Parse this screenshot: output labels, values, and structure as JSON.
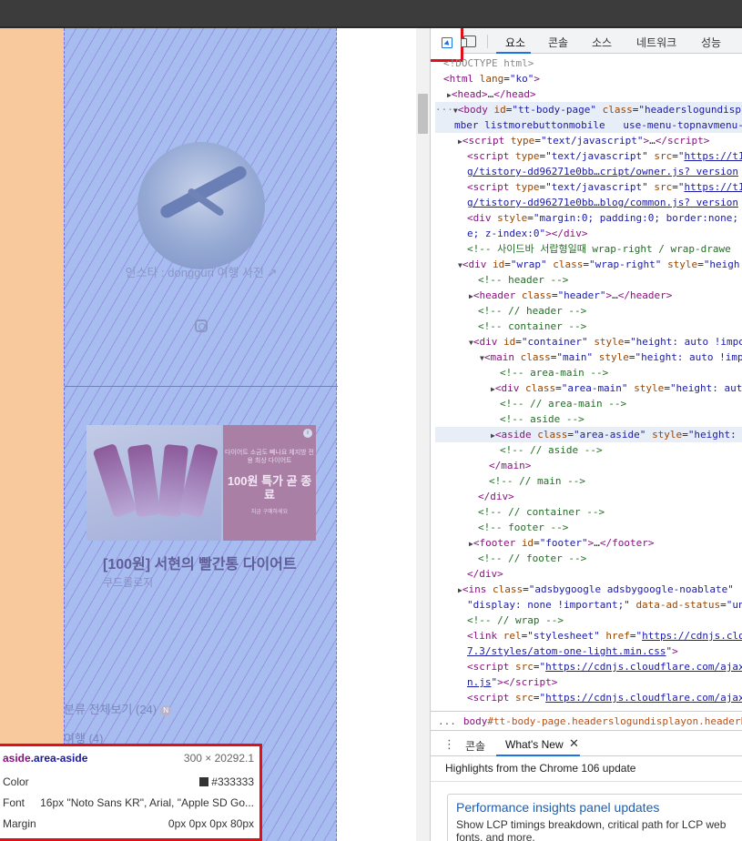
{
  "page": {
    "insta_caption": "인스타 : dongguri 여행 사진 ↗",
    "ad": {
      "small_text": "다이어트 소금도 빼나요 체지방 전용 최상 다이어트",
      "big_text": "100원 특가 곧 종료",
      "tiny_text": "지금 구매하세요",
      "info_label": "i",
      "title": "[100원] 서현의 빨간통 다이어트",
      "subtitle": "쿠드롤로지"
    },
    "categories": [
      {
        "label": "분류 전체보기 (24)",
        "badge": "N"
      },
      {
        "label": "여행 (4)"
      }
    ]
  },
  "tooltip": {
    "selector_tag": "aside",
    "selector_class": ".area-aside",
    "size": "300 × 20292.1",
    "rows": [
      {
        "key": "Color",
        "value": "#333333",
        "swatch": "#333333"
      },
      {
        "key": "Font",
        "value": "16px \"Noto Sans KR\", Arial, \"Apple SD Go..."
      },
      {
        "key": "Margin",
        "value": "0px 0px 0px 80px"
      }
    ]
  },
  "devtools": {
    "tabs": [
      "요소",
      "콘솔",
      "소스",
      "네트워크",
      "성능"
    ],
    "active_tab": "요소",
    "code_lines": [
      {
        "indent": 14,
        "html": "<span class='gray'>&lt;!DOCTYPE html&gt;</span>"
      },
      {
        "indent": 14,
        "html": "<span class='tag'>&lt;html</span> <span class='at'>lang</span>=<span class='av'>\"ko\"</span><span class='tag'>&gt;</span>"
      },
      {
        "indent": 18,
        "html": "<span class='tri'>▶</span><span class='tag'>&lt;head&gt;</span>…<span class='tag'>&lt;/head&gt;</span>"
      },
      {
        "indent": 2,
        "html": "<span class='gray'>···</span><span class='tri'>▼</span><span class='tag'>&lt;body</span> <span class='at'>id</span>=<span class='av'>\"tt-body-page\"</span> <span class='at'>class</span>=<span class='av'>\"headerslogundispl</span>",
        "selected": true
      },
      {
        "indent": 26,
        "html": "<span class='av'>mber listmorebuttonmobile   use-menu-topnavmenu-</span>",
        "selected": true
      },
      {
        "indent": 30,
        "html": "<span class='tri'>▶</span><span class='tag'>&lt;script</span> <span class='at'>type</span>=<span class='av'>\"text/javascript\"</span><span class='tag'>&gt;</span>…<span class='tag'>&lt;/script&gt;</span>"
      },
      {
        "indent": 40,
        "html": "<span class='tag'>&lt;script</span> <span class='at'>type</span>=<span class='av'>\"text/javascript\"</span> <span class='at'>src</span>=<span class='av'>\"<span class='lnk'>https://t1</span></span>"
      },
      {
        "indent": 40,
        "html": "<span class='lnk'>g/tistory-dd96271e0bb…cript/owner.js? version</span>"
      },
      {
        "indent": 40,
        "html": "<span class='tag'>&lt;script</span> <span class='at'>type</span>=<span class='av'>\"text/javascript\"</span> <span class='at'>src</span>=<span class='av'>\"<span class='lnk'>https://t1</span></span>"
      },
      {
        "indent": 40,
        "html": "<span class='lnk'>g/tistory-dd96271e0bb…blog/common.js? version</span>"
      },
      {
        "indent": 40,
        "html": "<span class='tag'>&lt;div</span> <span class='at'>style</span>=<span class='av'>\"margin:0; padding:0; border:none;</span>"
      },
      {
        "indent": 40,
        "html": "<span class='av'>e; z-index:0\"</span><span class='tag'>&gt;&lt;/div&gt;</span>"
      },
      {
        "indent": 40,
        "html": "<span class='cm'>&lt;!-- 사이드바 서랍형일때 wrap-right / wrap-drawe</span>"
      },
      {
        "indent": 30,
        "html": "<span class='tri'>▼</span><span class='tag'>&lt;div</span> <span class='at'>id</span>=<span class='av'>\"wrap\"</span> <span class='at'>class</span>=<span class='av'>\"wrap-right\"</span> <span class='at'>style</span>=<span class='av'>\"heigh</span>"
      },
      {
        "indent": 52,
        "html": "<span class='cm'>&lt;!-- header --&gt;</span>"
      },
      {
        "indent": 42,
        "html": "<span class='tri'>▶</span><span class='tag'>&lt;header</span> <span class='at'>class</span>=<span class='av'>\"header\"</span><span class='tag'>&gt;</span>…<span class='tag'>&lt;/header&gt;</span>"
      },
      {
        "indent": 52,
        "html": "<span class='cm'>&lt;!-- // header --&gt;</span>"
      },
      {
        "indent": 52,
        "html": "<span class='cm'>&lt;!-- container --&gt;</span>"
      },
      {
        "indent": 42,
        "html": "<span class='tri'>▼</span><span class='tag'>&lt;div</span> <span class='at'>id</span>=<span class='av'>\"container\"</span> <span class='at'>style</span>=<span class='av'>\"height: auto !impo</span>"
      },
      {
        "indent": 54,
        "html": "<span class='tri'>▼</span><span class='tag'>&lt;main</span> <span class='at'>class</span>=<span class='av'>\"main\"</span> <span class='at'>style</span>=<span class='av'>\"height: auto !imp</span>"
      },
      {
        "indent": 76,
        "html": "<span class='cm'>&lt;!-- area-main --&gt;</span>"
      },
      {
        "indent": 66,
        "html": "<span class='tri'>▶</span><span class='tag'>&lt;div</span> <span class='at'>class</span>=<span class='av'>\"area-main\"</span> <span class='at'>style</span>=<span class='av'>\"height: aut</span>"
      },
      {
        "indent": 76,
        "html": "<span class='cm'>&lt;!-- // area-main --&gt;</span>"
      },
      {
        "indent": 76,
        "html": "<span class='cm'>&lt;!-- aside --&gt;</span>"
      },
      {
        "indent": 66,
        "html": "<span class='tri'>▶</span><span class='tag'>&lt;aside</span> <span class='at'>class</span>=<span class='av'>\"area-aside\"</span> <span class='at'>style</span>=<span class='av'>\"height: </span>",
        "selected": true
      },
      {
        "indent": 76,
        "html": "<span class='cm'>&lt;!-- // aside --&gt;</span>"
      },
      {
        "indent": 64,
        "html": "<span class='tag'>&lt;/main&gt;</span>"
      },
      {
        "indent": 64,
        "html": "<span class='cm'>&lt;!-- // main --&gt;</span>"
      },
      {
        "indent": 52,
        "html": "<span class='tag'>&lt;/div&gt;</span>"
      },
      {
        "indent": 52,
        "html": "<span class='cm'>&lt;!-- // container --&gt;</span>"
      },
      {
        "indent": 52,
        "html": "<span class='cm'>&lt;!-- footer --&gt;</span>"
      },
      {
        "indent": 42,
        "html": "<span class='tri'>▶</span><span class='tag'>&lt;footer</span> <span class='at'>id</span>=<span class='av'>\"footer\"</span><span class='tag'>&gt;</span>…<span class='tag'>&lt;/footer&gt;</span>"
      },
      {
        "indent": 52,
        "html": "<span class='cm'>&lt;!-- // footer --&gt;</span>"
      },
      {
        "indent": 40,
        "html": "<span class='tag'>&lt;/div&gt;</span>"
      },
      {
        "indent": 30,
        "html": "<span class='tri'>▶</span><span class='tag'>&lt;ins</span> <span class='at'>class</span>=<span class='av'>\"adsbygoogle adsbygoogle-noablate\"</span>"
      },
      {
        "indent": 40,
        "html": "<span class='av'>\"display: none !important;\"</span> <span class='at'>data-ad-status</span>=<span class='av'>\"un</span>"
      },
      {
        "indent": 40,
        "html": "<span class='cm'>&lt;!-- // wrap --&gt;</span>"
      },
      {
        "indent": 40,
        "html": "<span class='tag'>&lt;link</span> <span class='at'>rel</span>=<span class='av'>\"stylesheet\"</span> <span class='at'>href</span>=<span class='av'>\"<span class='lnk'>https://cdnjs.clou</span></span>"
      },
      {
        "indent": 40,
        "html": "<span class='lnk'>7.3/styles/atom-one-light.min.css</span><span class='av'>\"</span><span class='tag'>&gt;</span>"
      },
      {
        "indent": 40,
        "html": "<span class='tag'>&lt;script</span> <span class='at'>src</span>=<span class='av'>\"<span class='lnk'>https://cdnjs.cloudflare.com/ajax</span></span>"
      },
      {
        "indent": 40,
        "html": "<span class='lnk'>n.js</span><span class='av'>\"</span><span class='tag'>&gt;&lt;/script&gt;</span>"
      },
      {
        "indent": 40,
        "html": "<span class='tag'>&lt;script</span> <span class='at'>src</span>=<span class='av'>\"<span class='lnk'>https://cdnjs.cloudflare.com/ajax</span></span>"
      }
    ],
    "breadcrumb": {
      "dots": "...",
      "tag": "body",
      "rest": "#tt-body-page.headerslogundisplayon.headerbanner"
    },
    "drawer": {
      "menu_icon": "⋮",
      "tab_console": "콘솔",
      "tab_whatsnew": "What's New",
      "close_icon": "✕",
      "highlights": "Highlights from the Chrome 106 update",
      "card_title": "Performance insights panel updates",
      "card_body_line1": "Show LCP timings breakdown, critical path for LCP web",
      "card_body_line2": "fonts, and more."
    }
  }
}
